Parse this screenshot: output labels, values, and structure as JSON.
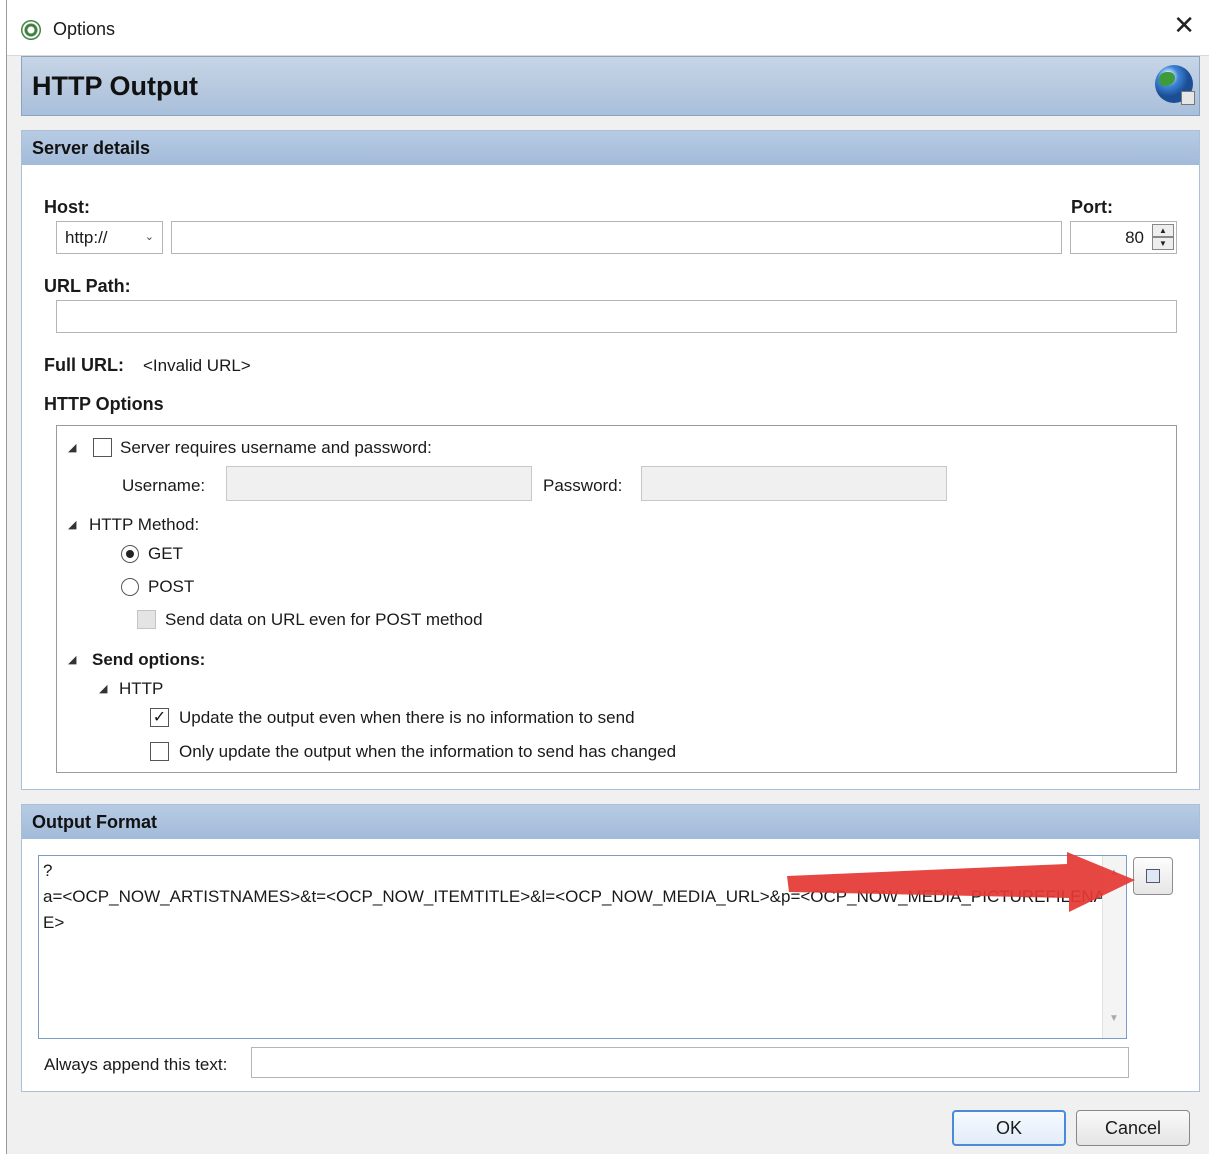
{
  "window": {
    "title": "Options"
  },
  "header": {
    "title": "HTTP Output"
  },
  "server_details": {
    "heading": "Server details",
    "host_label": "Host:",
    "protocol_value": "http://",
    "host_value": "",
    "port_label": "Port:",
    "port_value": "80",
    "url_path_label": "URL Path:",
    "url_path_value": "",
    "full_url_label": "Full URL:",
    "full_url_value": "<Invalid URL>",
    "http_options_label": "HTTP Options",
    "auth": {
      "label": "Server requires username and password:",
      "checked": false,
      "username_label": "Username:",
      "password_label": "Password:"
    },
    "method": {
      "label": "HTTP Method:",
      "get_label": "GET",
      "post_label": "POST",
      "selected": "GET",
      "send_on_url_label": "Send data on URL even for POST method"
    },
    "send_options": {
      "label": "Send options:",
      "http_label": "HTTP",
      "update_always_label": "Update the output even when there is no information to send",
      "update_always_checked": true,
      "update_changed_label": "Only update the output when the information to send has changed",
      "update_changed_checked": false
    }
  },
  "output_format": {
    "heading": "Output Format",
    "text": "?\na=<OCP_NOW_ARTISTNAMES>&t=<OCP_NOW_ITEMTITLE>&l=<OCP_NOW_MEDIA_URL>&p=<OCP_NOW_MEDIA_PICTUREFILENAME>",
    "append_label": "Always append this text:",
    "append_value": ""
  },
  "buttons": {
    "ok": "OK",
    "cancel": "Cancel"
  },
  "colors": {
    "header_bg": "#a9bfda",
    "panel_border": "#a9bfda",
    "annotation_arrow": "#e53935",
    "ok_border": "#4a8bd6"
  },
  "icons": [
    "app-icon",
    "close-icon",
    "globe-icon",
    "insert-tag-icon"
  ]
}
